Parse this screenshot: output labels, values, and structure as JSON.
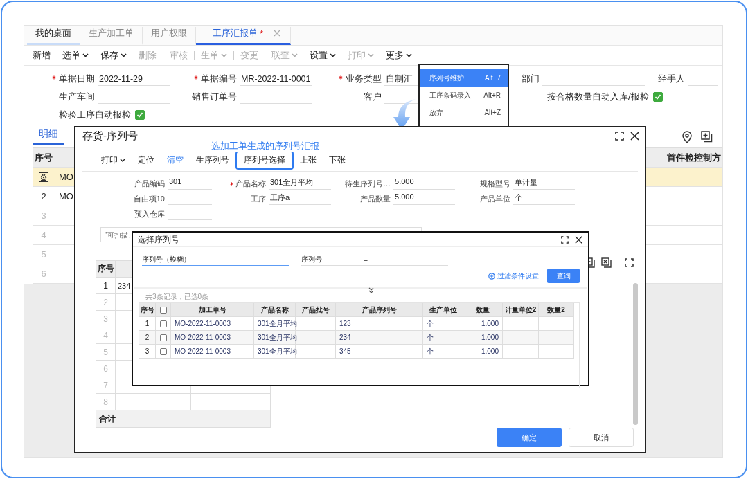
{
  "tabs": [
    {
      "label": "我的桌面",
      "selected": false,
      "closable": false
    },
    {
      "label": "生产加工单",
      "selected": false,
      "closable": false
    },
    {
      "label": "用户权限",
      "selected": false,
      "closable": false
    },
    {
      "label": "工序汇报单",
      "suffix": "*",
      "selected": true,
      "closable": true
    }
  ],
  "toolbar": [
    {
      "label": "新增",
      "dropdown": false,
      "disabled": false
    },
    {
      "label": "选单",
      "dropdown": true,
      "disabled": false
    },
    {
      "label": "保存",
      "dropdown": true,
      "disabled": false
    },
    {
      "label": "删除",
      "dropdown": false,
      "disabled": true
    },
    {
      "label": "审核",
      "dropdown": false,
      "disabled": true
    },
    {
      "label": "生单",
      "dropdown": true,
      "disabled": true
    },
    {
      "label": "变更",
      "dropdown": false,
      "disabled": true
    },
    {
      "label": "联查",
      "dropdown": true,
      "disabled": true
    },
    {
      "label": "设置",
      "dropdown": true,
      "disabled": false
    },
    {
      "label": "打印",
      "dropdown": true,
      "disabled": true
    },
    {
      "label": "更多",
      "dropdown": true,
      "disabled": false
    }
  ],
  "more_menu": [
    {
      "label": "序列号维护",
      "shortcut": "Alt+7",
      "selected": true
    },
    {
      "label": "工序条码录入",
      "shortcut": "Alt+R",
      "selected": false
    },
    {
      "label": "放弃",
      "shortcut": "Alt+Z",
      "selected": false
    }
  ],
  "form": {
    "rows": [
      [
        {
          "kind": "field",
          "label": "单据日期",
          "value": "2022-11-29",
          "required": true
        },
        {
          "kind": "field",
          "label": "单据编号",
          "value": "MR-2022-11-0001",
          "required": true
        },
        {
          "kind": "field",
          "label": "业务类型",
          "value": "自制汇",
          "required": true
        },
        {
          "kind": "field",
          "label": "部门",
          "required": false
        },
        {
          "kind": "field",
          "label": "经手人",
          "required": false
        }
      ],
      [
        {
          "kind": "field",
          "label": "生产车间",
          "required": false
        },
        {
          "kind": "field",
          "label": "销售订单号",
          "required": false
        },
        {
          "kind": "field",
          "label": "客户",
          "required": false
        },
        {
          "kind": "checkbox",
          "label": "按合格数量自动入库/报检",
          "checked": true
        }
      ],
      [
        {
          "kind": "checkbox",
          "label": "检验工序自动报检",
          "checked": true
        }
      ]
    ]
  },
  "detail": {
    "tab": "明细",
    "columns": [
      {
        "label": "序号"
      },
      {
        "label": "首件检控制方"
      }
    ],
    "rows": [
      {
        "cell": "MO",
        "selected": true
      },
      {
        "number": "2",
        "cell": "MO",
        "selected": false
      },
      {
        "number": "3",
        "selected": false
      },
      {
        "number": "4",
        "selected": false
      },
      {
        "number": "5",
        "selected": false
      },
      {
        "number": "6",
        "selected": false
      }
    ]
  },
  "serial_dialog": {
    "title": "存货-序列号",
    "annotation": "选加工单生成的序列号汇报",
    "toolbar": [
      {
        "label": "打印",
        "kind": "dropdown"
      },
      {
        "label": "定位",
        "kind": "plain"
      },
      {
        "label": "清空",
        "kind": "link"
      },
      {
        "label": "生序列号",
        "kind": "plain"
      },
      {
        "label": "序列号选择",
        "kind": "outlined"
      },
      {
        "label": "上张",
        "kind": "plain"
      },
      {
        "label": "下张",
        "kind": "plain"
      }
    ],
    "fields": [
      [
        {
          "label": "产品编码",
          "value": "301",
          "required": false
        },
        {
          "label": "产品名称",
          "value": "301全月平均",
          "required": true
        },
        {
          "label": "待生序列号…",
          "value": "5.000",
          "required": false
        },
        {
          "label": "规格型号",
          "value": "单计量",
          "required": false
        }
      ],
      [
        {
          "label": "自由项10",
          "required": false
        },
        {
          "label": "工序",
          "value": "工序a",
          "required": false
        },
        {
          "label": "产品数量",
          "value": "5.000",
          "required": false
        },
        {
          "label": "产品单位",
          "value": "个",
          "required": false
        }
      ],
      [
        {
          "label": "预入仓库",
          "required": false
        }
      ]
    ],
    "search": {
      "placeholder": "\"可扫描、"
    },
    "table": {
      "columns": [
        "序号"
      ],
      "rows": [
        {
          "number": "1",
          "value": "234"
        },
        {
          "number": "2"
        },
        {
          "number": "3"
        },
        {
          "number": "4"
        },
        {
          "number": "5"
        },
        {
          "number": "6"
        },
        {
          "number": "7"
        },
        {
          "number": "8"
        }
      ],
      "total_label": "合计"
    },
    "buttons": [
      {
        "label": "确定",
        "kind": "primary"
      },
      {
        "label": "取消",
        "kind": "default"
      }
    ]
  },
  "picker": {
    "title": "选择序列号",
    "filters": [
      {
        "label": "序列号（模糊）",
        "focused": true
      },
      {
        "label": "序列号",
        "value": "–",
        "focused": false
      }
    ],
    "filter_link": "过滤条件设置",
    "query_button": "查询",
    "summary": "共3条记录，已选0条",
    "all_checked": false,
    "columns": [
      "序号",
      "加工单号",
      "产品名称",
      "产品批号",
      "产品序列号",
      "生产单位",
      "数量",
      "计量单位2",
      "数量2"
    ],
    "rows": [
      {
        "number": "1",
        "checked": false,
        "order": "MO-2022-11-0003",
        "product": "301全月平均",
        "serial": "123",
        "unit": "个",
        "qty": "1.000"
      },
      {
        "number": "2",
        "checked": false,
        "order": "MO-2022-11-0003",
        "product": "301全月平均",
        "serial": "234",
        "unit": "个",
        "qty": "1.000"
      },
      {
        "number": "3",
        "checked": false,
        "order": "MO-2022-11-0003",
        "product": "301全月平均",
        "serial": "345",
        "unit": "个",
        "qty": "1.000"
      }
    ]
  }
}
